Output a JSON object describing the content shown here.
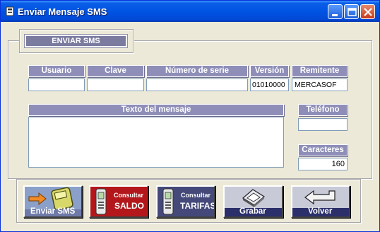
{
  "window": {
    "title": "Enviar Mensaje SMS"
  },
  "header": {
    "label": "ENVIAR SMS"
  },
  "fields": {
    "usuario": {
      "label": "Usuario",
      "value": ""
    },
    "clave": {
      "label": "Clave",
      "value": ""
    },
    "serie": {
      "label": "Número de serie",
      "value": ""
    },
    "version": {
      "label": "Versión",
      "value": "01010000"
    },
    "remitente": {
      "label": "Remitente",
      "value": "MERCASOF"
    },
    "mensaje": {
      "label": "Texto del mensaje",
      "value": ""
    },
    "telefono": {
      "label": "Teléfono",
      "value": ""
    },
    "caracteres": {
      "label": "Caracteres",
      "value": "160"
    }
  },
  "buttons": {
    "enviar": {
      "label": "Enviar SMS",
      "color": "#6E7AA8"
    },
    "saldo": {
      "line1": "Consultar",
      "line2": "SALDO",
      "color": "#B3171B"
    },
    "tarifas": {
      "line1": "Consultar",
      "line2": "TARIFAS",
      "color": "#44497A"
    },
    "grabar": {
      "label": "Grabar",
      "color": "#2B2F6A"
    },
    "volver": {
      "label": "Volver",
      "color": "#2B2F6A"
    }
  },
  "icons": {
    "app": "app-icon",
    "minimize": "minimize-icon",
    "maximize": "maximize-icon",
    "close": "close-icon",
    "enviar": "phone-arrow-icon",
    "saldo": "mobile-phone-icon",
    "tarifas": "mobile-phone-icon",
    "grabar": "diskette-icon",
    "volver": "return-arrow-icon"
  }
}
